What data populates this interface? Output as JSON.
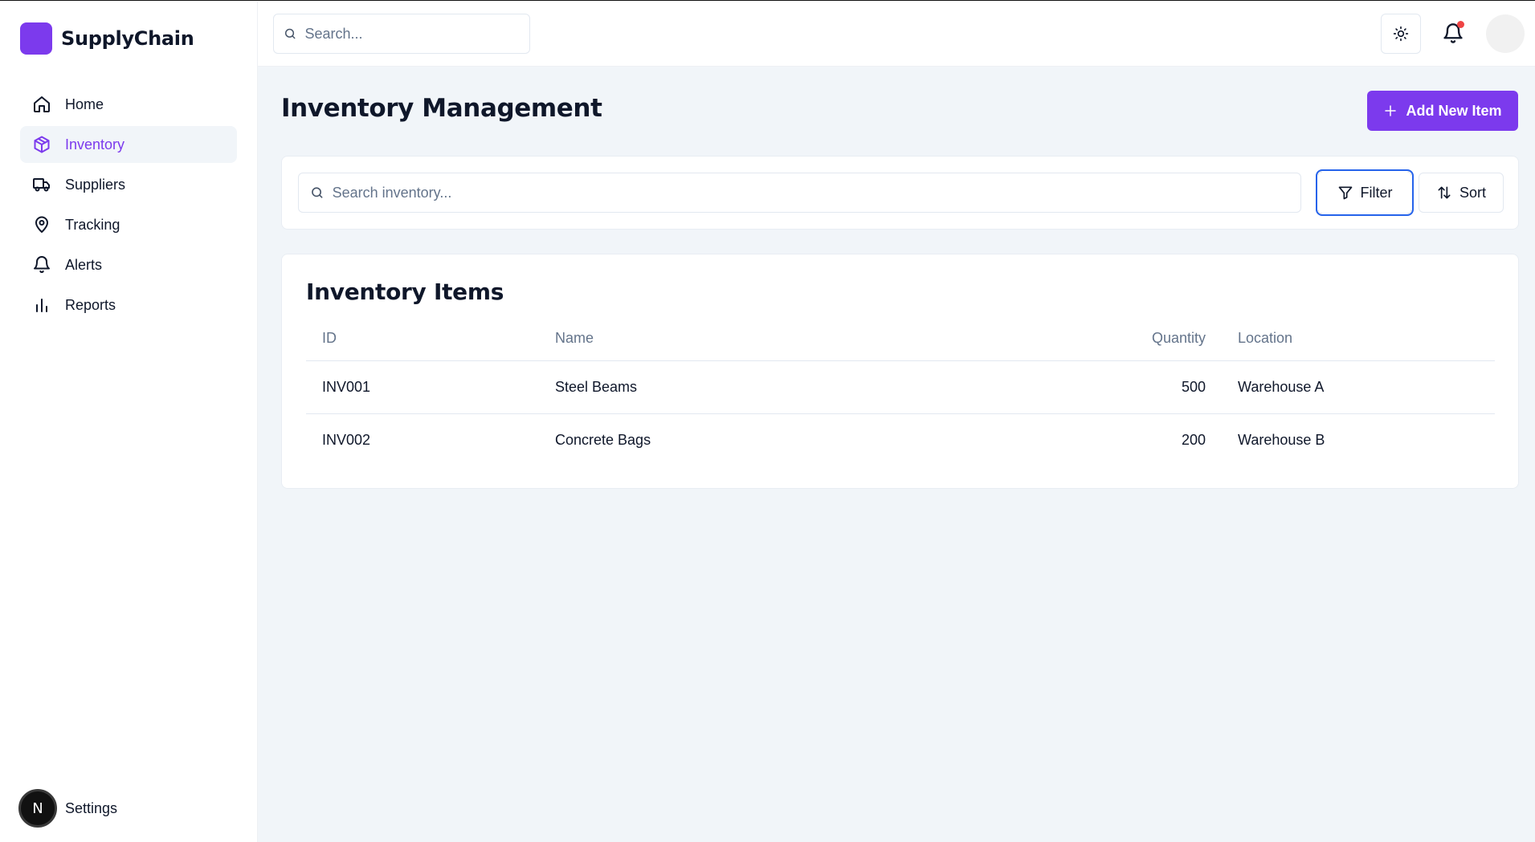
{
  "brand": {
    "name": "SupplyChain",
    "color": "#7c3aed"
  },
  "sidebar": {
    "items": [
      {
        "label": "Home",
        "icon": "home-icon",
        "active": false
      },
      {
        "label": "Inventory",
        "icon": "package-icon",
        "active": true
      },
      {
        "label": "Suppliers",
        "icon": "truck-icon",
        "active": false
      },
      {
        "label": "Tracking",
        "icon": "map-pin-icon",
        "active": false
      },
      {
        "label": "Alerts",
        "icon": "bell-icon",
        "active": false
      },
      {
        "label": "Reports",
        "icon": "bar-chart-icon",
        "active": false
      }
    ],
    "settings": {
      "label": "Settings",
      "avatar_letter": "N"
    }
  },
  "topbar": {
    "search_placeholder": "Search...",
    "notification_dot_color": "#ef4444"
  },
  "main": {
    "title": "Inventory Management",
    "add_button_label": "Add New Item",
    "search_placeholder": "Search inventory...",
    "filter_label": "Filter",
    "sort_label": "Sort",
    "table": {
      "title": "Inventory Items",
      "headers": [
        "ID",
        "Name",
        "Quantity",
        "Location"
      ],
      "rows": [
        {
          "id": "INV001",
          "name": "Steel Beams",
          "quantity": "500",
          "location": "Warehouse A"
        },
        {
          "id": "INV002",
          "name": "Concrete Bags",
          "quantity": "200",
          "location": "Warehouse B"
        }
      ]
    }
  }
}
